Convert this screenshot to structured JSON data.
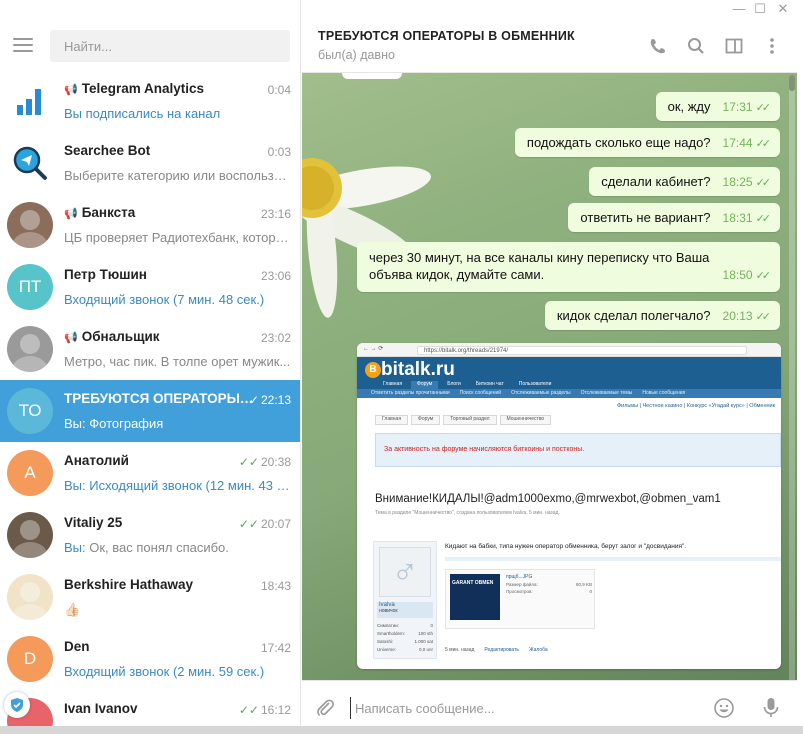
{
  "window": {
    "minimize": "—",
    "maximize": "☐",
    "close": "✕"
  },
  "sidebar": {
    "search_placeholder": "Найти...",
    "chats": [
      {
        "name": "Telegram Analytics",
        "channel": true,
        "time": "0:04",
        "last": "Вы подписались на канал",
        "last_blue": true,
        "avatar": "bars",
        "avatar_color": "#2a8ad6"
      },
      {
        "name": "Searchee Bot",
        "channel": false,
        "time": "0:03",
        "last": "Выберите категорию или воспользуйтесь поиском",
        "last_blue": false,
        "avatar": "search",
        "avatar_color": "#2aa3df"
      },
      {
        "name": "Банкста",
        "channel": true,
        "time": "23:16",
        "last": "ЦБ проверяет Радиотехбанк, которы...",
        "last_blue": false,
        "avatar": "photo",
        "avatar_color": "#8a6d5b"
      },
      {
        "name": "Петр Тюшин",
        "channel": false,
        "time": "23:06",
        "last": "Входящий звонок (7 мин. 48 сек.)",
        "last_blue": true,
        "avatar": "initials",
        "initials": "ПТ",
        "avatar_color": "#56c4c9"
      },
      {
        "name": "Обнальщик",
        "channel": true,
        "time": "23:02",
        "last": "Метро, час пик.  В толпе орет мужик...",
        "last_blue": false,
        "avatar": "photo",
        "avatar_color": "#9a9a9a"
      },
      {
        "name": "ТРЕБУЮТСЯ ОПЕРАТОРЫ В ОБМЕННИК",
        "channel": false,
        "time": "22:13",
        "ticks": "✓",
        "last": "Вы: Фотография",
        "last_blue": false,
        "active": true,
        "avatar": "initials",
        "initials": "ТО",
        "avatar_color": "#5cb8d9"
      },
      {
        "name": "Анатолий",
        "channel": false,
        "time": "20:38",
        "ticks": "✓✓",
        "last": "Вы: Исходящий звонок (12 мин. 43 сек.)",
        "last_blue": true,
        "avatar": "initials",
        "initials": "А",
        "avatar_color": "#f49a5b"
      },
      {
        "name": "Vitaliy 25",
        "channel": false,
        "time": "20:07",
        "ticks": "✓✓",
        "last_prefix": "Вы:",
        "last": " Ок, вас понял спасибо.",
        "last_blue": false,
        "avatar": "photo",
        "avatar_color": "#6b5a4a"
      },
      {
        "name": "Berkshire Hathaway",
        "channel": false,
        "time": "18:43",
        "last": "👍🏻",
        "last_blue": false,
        "avatar": "photo",
        "avatar_color": "#f0e3c8"
      },
      {
        "name": "Den",
        "channel": false,
        "time": "17:42",
        "last": "Входящий звонок (2 мин. 59 сек.)",
        "last_blue": true,
        "avatar": "initials",
        "initials": "D",
        "avatar_color": "#f49a5b"
      },
      {
        "name": "Ivan Ivanov",
        "channel": false,
        "time": "16:12",
        "ticks": "✓✓",
        "last": "",
        "last_blue": false,
        "avatar": "initials",
        "initials": "",
        "avatar_color": "#e8646b"
      }
    ]
  },
  "conversation": {
    "title": "ТРЕБУЮТСЯ ОПЕРАТОРЫ В ОБМЕННИК",
    "status": "был(а) давно",
    "messages": [
      {
        "text": "ок, жду",
        "time": "17:31"
      },
      {
        "text": "подождать сколько еще надо?",
        "time": "17:44"
      },
      {
        "text": "сделали кабинет?",
        "time": "18:25"
      },
      {
        "text": "ответить не вариант?",
        "time": "18:31"
      },
      {
        "text_line1": "через 30 минут, на все каналы кину переписку что Ваша",
        "text_line2": "объява кидок, думайте сами.",
        "time": "18:50"
      },
      {
        "text": "кидок сделал полегчало?",
        "time": "20:13"
      }
    ],
    "composer_placeholder": "Написать сообщение..."
  },
  "photo": {
    "url": "https://bitalk.org/threads/21974/",
    "logo": "bitalk.ru",
    "nav": [
      "Главная",
      "Форум",
      "Блоги",
      "Биткоин чат",
      "Пользователи"
    ],
    "subnav": [
      "Отметить разделы прочитанными",
      "Поиск сообщений",
      "Отслеживаемые разделы",
      "Отслеживаемые темы",
      "Новые сообщения"
    ],
    "top_links": "Фильмы  |  Честное казино  |  Конкурс «Угадай курс»  |  Обменник",
    "breadcrumb": [
      "Главная",
      "Форум",
      "Торговый раздел",
      "Мошенничество"
    ],
    "notice": "За активность на форуме начисляются биткоины и постконы.",
    "thread_title": "Внимание!КИДАЛЫ!@adm1000exmo,@mrwexbot,@obmen_vam1",
    "thread_meta": "Тема в разделе \"Мошенничество\", создана пользователем Ivalva, 5 мин. назад.",
    "post_text": "Кидают на бабки, типа нужен оператор обменника, берут залог и \"досвидания\".",
    "user_name": "Ivalva",
    "user_rank": "новичок",
    "user_stats": [
      [
        "Симпатии:",
        "0"
      ],
      [
        "Smartholdem:",
        "100 sth"
      ],
      [
        "Satoshi:",
        "1.000 sat"
      ],
      [
        "Universe:",
        "0,0 unr"
      ]
    ],
    "attach_title": "прщб...JPG",
    "attach_size_label": "Размер файла:",
    "attach_size": "80,9 KB",
    "attach_views_label": "Просмотров:",
    "attach_views": "0",
    "attach_thumb": "GARANT OBMEN",
    "footer": [
      "5 мин. назад",
      "Редактировать",
      "Жалоба"
    ]
  },
  "colors": {
    "accent": "#419fd9",
    "bubble": "#effdde",
    "tick": "#5fb450",
    "link": "#3a8ac4"
  }
}
